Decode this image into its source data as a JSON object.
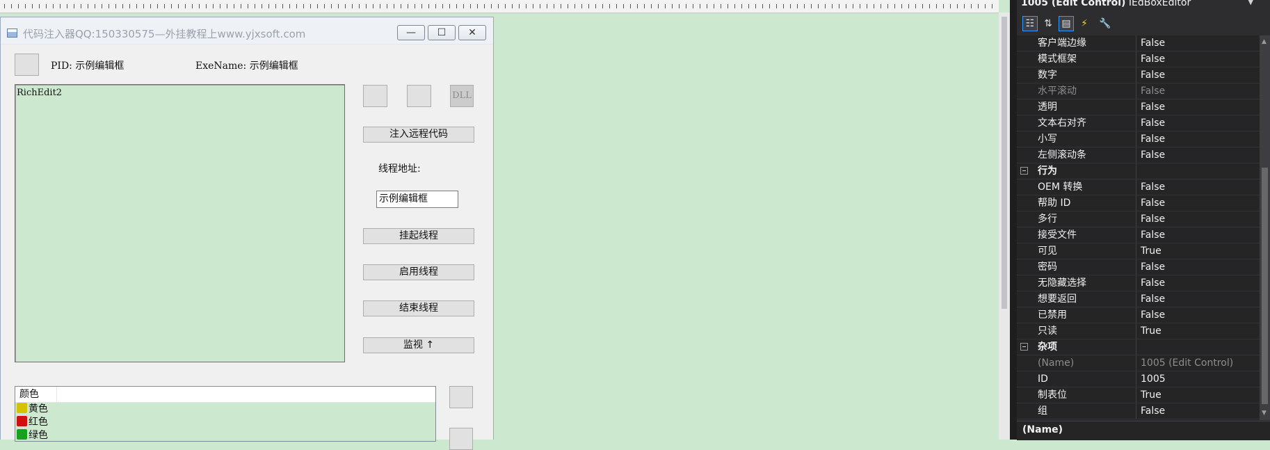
{
  "dialog": {
    "title": "代码注入器QQ:150330575—外挂教程上www.yjxsoft.com",
    "caption_buttons": {
      "minimize": "—",
      "maximize": "☐",
      "close": "✕"
    },
    "pid_label": "PID: 示例编辑框",
    "exename_label": "ExeName: 示例编辑框",
    "richedit_text": "RichEdit2",
    "dll_button": "DLL",
    "inject_button": "注入远程代码",
    "thread_addr_label": "线程地址:",
    "thread_addr_value": "示例编辑框",
    "suspend_button": "挂起线程",
    "resume_button": "启用线程",
    "end_button": "结束线程",
    "monitor_button": "监视 ↑",
    "listview": {
      "header": "颜色",
      "rows": [
        {
          "label": "黄色",
          "color": "#d4c300"
        },
        {
          "label": "红色",
          "color": "#d01010"
        },
        {
          "label": "绿色",
          "color": "#18a020"
        }
      ]
    }
  },
  "properties": {
    "object_name": "1005 (Edit Control)",
    "object_type": "IEdBoxEditor",
    "rows": [
      {
        "name": "客户端边缘",
        "value": "False"
      },
      {
        "name": "模式框架",
        "value": "False"
      },
      {
        "name": "数字",
        "value": "False"
      },
      {
        "name": "水平滚动",
        "value": "False",
        "disabled": true
      },
      {
        "name": "透明",
        "value": "False"
      },
      {
        "name": "文本右对齐",
        "value": "False"
      },
      {
        "name": "小写",
        "value": "False"
      },
      {
        "name": "左侧滚动条",
        "value": "False"
      }
    ],
    "category_behavior": "行为",
    "behavior_rows": [
      {
        "name": "OEM 转换",
        "value": "False"
      },
      {
        "name": "帮助 ID",
        "value": "False"
      },
      {
        "name": "多行",
        "value": "False"
      },
      {
        "name": "接受文件",
        "value": "False"
      },
      {
        "name": "可见",
        "value": "True"
      },
      {
        "name": "密码",
        "value": "False"
      },
      {
        "name": "无隐藏选择",
        "value": "False"
      },
      {
        "name": "想要返回",
        "value": "False"
      },
      {
        "name": "已禁用",
        "value": "False"
      },
      {
        "name": "只读",
        "value": "True"
      }
    ],
    "category_misc": "杂项",
    "misc_rows": [
      {
        "name": "(Name)",
        "value": "1005 (Edit Control)",
        "disabled": true
      },
      {
        "name": "ID",
        "value": "1005"
      },
      {
        "name": "制表位",
        "value": "True"
      },
      {
        "name": "组",
        "value": "False"
      }
    ],
    "description_name": "(Name)"
  }
}
